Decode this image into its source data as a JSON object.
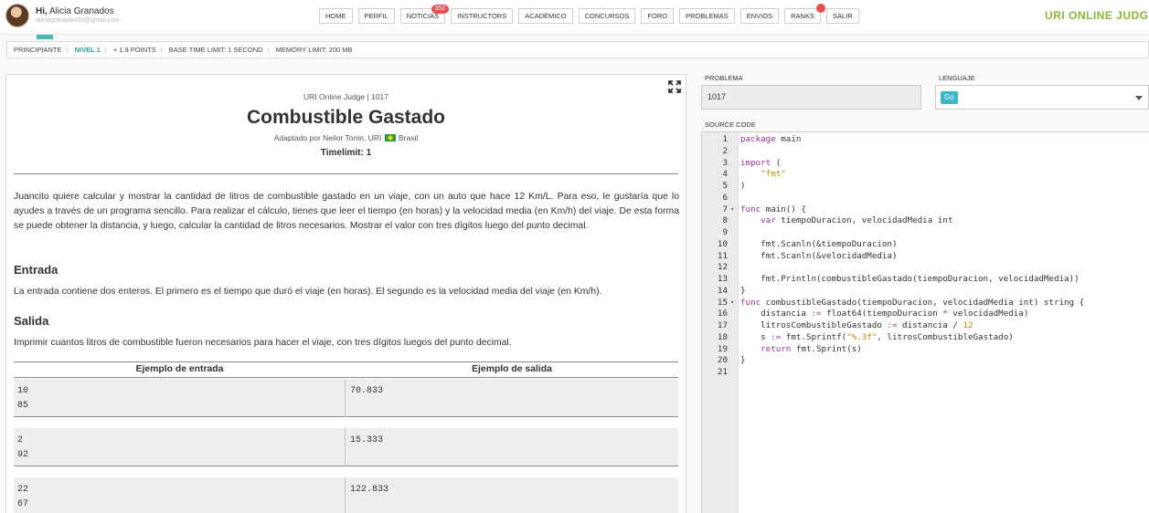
{
  "header": {
    "greeting": "Hi,",
    "user_name": "Alicia Granados",
    "user_email": "aliciagranados33@gmail.com",
    "brand": "URI ONLINE JUDGE",
    "nav": [
      {
        "label": "HOME"
      },
      {
        "label": "PERFIL"
      },
      {
        "label": "NOTICIAS",
        "badge": "352"
      },
      {
        "label": "INSTRUCTORS"
      },
      {
        "label": "ACADÉMICO"
      },
      {
        "label": "CONCURSOS"
      },
      {
        "label": "FORO"
      },
      {
        "label": "PROBLEMAS"
      },
      {
        "label": "ENVIOS"
      },
      {
        "label": "RANKS"
      },
      {
        "label": "SALIR"
      }
    ]
  },
  "infobar": {
    "category": "PRINCIPIANTE",
    "level": "NIVEL 1",
    "points": "+ 1.9 POINTS",
    "base_time": "BASE TIME LIMIT: 1 SECOND",
    "memory": "MEMORY LIMIT: 200 MB"
  },
  "problem": {
    "source": "URI Online Judge | 1017",
    "title": "Combustible Gastado",
    "author_prefix": "Adaptado por Neilor Tonin, URI",
    "author_country": "Brasil",
    "timelimit": "Timelimit: 1",
    "description": "Juancito quiere calcular y mostrar la cantidad de litros de combustible gastado en un viaje, con un auto que hace 12 Km/L. Para eso, le gustaría que lo ayudes a través de un programa sencillo. Para realizar el cálculo, tienes que leer el tiempo (en horas) y la velocidad media (en Km/h) del viaje. De esta forma se puede obtener la distancia, y luego, calcular la cantidad de litros necesarios. Mostrar el valor con tres dígitos luego del punto decimal.",
    "input_heading": "Entrada",
    "input_text": "La entrada contiene dos enteros. El primero es el tiempo que duró el viaje (en horas). El segundo es la velocidad media del viaje (en Km/h).",
    "output_heading": "Salida",
    "output_text": "Imprimir cuantos litros de combustible fueron necesarios para hacer el viaje, con tres dígitos luegos del punto decimal.",
    "examples_header_in": "Ejemplo de entrada",
    "examples_header_out": "Ejemplo de salida",
    "examples": [
      {
        "input": "10\n85",
        "output": "70.833"
      },
      {
        "input": "2\n92",
        "output": "15.333"
      },
      {
        "input": "22\n67",
        "output": "122.833"
      }
    ]
  },
  "submit": {
    "problem_label": "PROBLEMA",
    "problem_value": "1017",
    "language_label": "LENGUAJE",
    "language_value": "Go",
    "source_label": "SOURCE CODE"
  },
  "code": {
    "lines": [
      {
        "n": "1",
        "t": "package main"
      },
      {
        "n": "2",
        "t": ""
      },
      {
        "n": "3",
        "t": "import ("
      },
      {
        "n": "4",
        "t": "    \"fmt\""
      },
      {
        "n": "5",
        "t": ")"
      },
      {
        "n": "6",
        "t": ""
      },
      {
        "n": "7",
        "t": "func main() {",
        "fold": true
      },
      {
        "n": "8",
        "t": "    var tiempoDuracion, velocidadMedia int"
      },
      {
        "n": "9",
        "t": ""
      },
      {
        "n": "10",
        "t": "    fmt.Scanln(&tiempoDuracion)"
      },
      {
        "n": "11",
        "t": "    fmt.Scanln(&velocidadMedia)"
      },
      {
        "n": "12",
        "t": ""
      },
      {
        "n": "13",
        "t": "    fmt.Println(combustibleGastado(tiempoDuracion, velocidadMedia))"
      },
      {
        "n": "14",
        "t": "}"
      },
      {
        "n": "15",
        "t": "func combustibleGastado(tiempoDuracion, velocidadMedia int) string {",
        "fold": true
      },
      {
        "n": "16",
        "t": "    distancia := float64(tiempoDuracion * velocidadMedia)"
      },
      {
        "n": "17",
        "t": "    litrosCombustibleGastado := distancia / 12"
      },
      {
        "n": "18",
        "t": "    s := fmt.Sprintf(\"%.3f\", litrosCombustibleGastado)"
      },
      {
        "n": "19",
        "t": "    return fmt.Sprint(s)"
      },
      {
        "n": "20",
        "t": "}"
      },
      {
        "n": "21",
        "t": ""
      }
    ]
  },
  "colors": {
    "accent_teal": "#2d9c94",
    "brand_green": "#8bb63a",
    "badge_red": "#e8504f",
    "go_chip": "#3bb8c5"
  }
}
